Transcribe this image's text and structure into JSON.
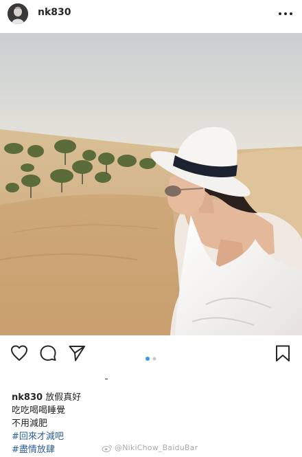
{
  "header": {
    "username": "nk830",
    "more_icon": "more-horizontal-icon"
  },
  "photo": {
    "alt": "woman in white hat in desert"
  },
  "actions": {
    "like_icon": "heart-icon",
    "comment_icon": "comment-icon",
    "share_icon": "send-icon",
    "save_icon": "bookmark-icon",
    "carousel_pages": 2,
    "carousel_active": 1
  },
  "caption": {
    "username": "nk830",
    "line1": "放假真好",
    "line2": "吃吃喝喝睡覺",
    "line3": "不用減肥",
    "hashtag1": "#回來才減吧",
    "hashtag2": "#盡情放肆"
  },
  "watermark": {
    "text": "@NikiChow_BaiduBar"
  },
  "colors": {
    "hashtag": "#2b5f97",
    "carousel_active": "#3897f0",
    "carousel_inactive": "#c7c7c7"
  }
}
